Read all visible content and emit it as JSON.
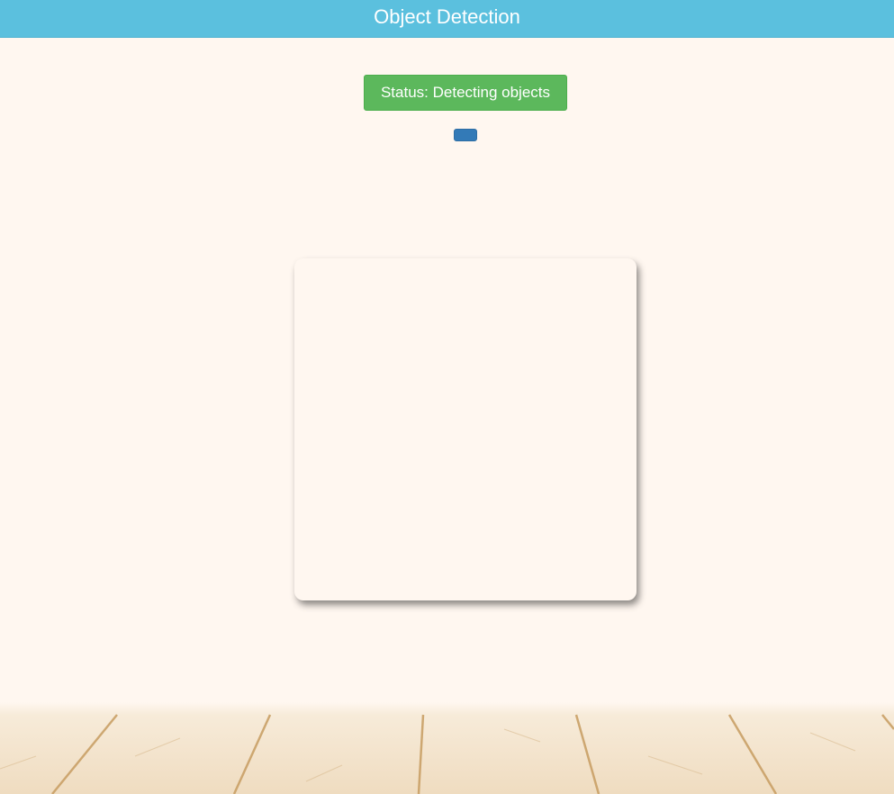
{
  "header": {
    "title": "Object Detection"
  },
  "status": {
    "text": "Status: Detecting objects"
  },
  "action_button": {
    "label": ""
  },
  "colors": {
    "header_bg": "#5bc0de",
    "page_bg": "#fff7f0",
    "status_bg": "#5cb85c",
    "button_bg": "#337ab7"
  }
}
